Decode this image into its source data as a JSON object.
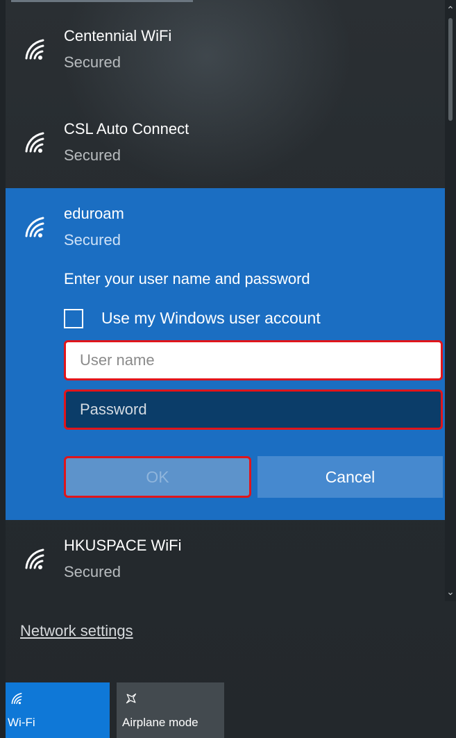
{
  "networks": [
    {
      "name": "Centennial WiFi",
      "status": "Secured"
    },
    {
      "name": "CSL Auto Connect",
      "status": "Secured"
    },
    {
      "name": "eduroam",
      "status": "Secured"
    },
    {
      "name": "HKUSPACE WiFi",
      "status": "Secured"
    }
  ],
  "connect_form": {
    "prompt": "Enter your user name and password",
    "checkbox_label": "Use my Windows user account",
    "checkbox_checked": false,
    "username_placeholder": "User name",
    "username_value": "",
    "password_placeholder": "Password",
    "password_value": "",
    "ok_label": "OK",
    "cancel_label": "Cancel"
  },
  "footer": {
    "settings_link": "Network settings",
    "tiles": [
      {
        "label": "Wi-Fi",
        "icon": "wifi-icon",
        "active": true
      },
      {
        "label": "Airplane mode",
        "icon": "airplane-icon",
        "active": false
      }
    ]
  },
  "colors": {
    "accent": "#1b6ec2",
    "active_tile": "#0f78d7",
    "highlight_border": "#e0151b",
    "panel": "#262b2f"
  },
  "icons": [
    "wifi-icon",
    "chevron-up-icon",
    "chevron-down-icon",
    "airplane-icon"
  ]
}
